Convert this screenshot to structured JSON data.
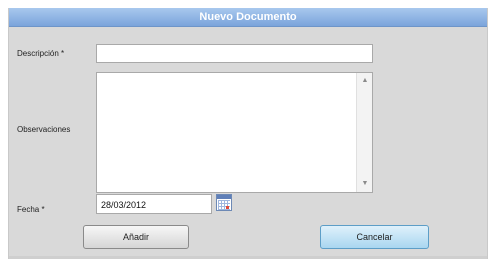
{
  "dialog": {
    "title": "Nuevo Documento",
    "fields": {
      "descripcion_label": "Descripción *",
      "descripcion_value": "",
      "observaciones_label": "Observaciones",
      "observaciones_value": "",
      "fecha_label": "Fecha *",
      "fecha_value": "28/03/2012"
    },
    "buttons": {
      "add_label": "Añadir",
      "cancel_label": "Cancelar"
    }
  },
  "icons": {
    "calendar": "calendar-icon",
    "scroll_up": "scroll-up-arrow-icon",
    "scroll_down": "scroll-down-arrow-icon"
  },
  "colors": {
    "title_bar": "#7ba4db",
    "dialog_bg": "#d9d9d9",
    "cancel_button": "#a9d6f0"
  }
}
